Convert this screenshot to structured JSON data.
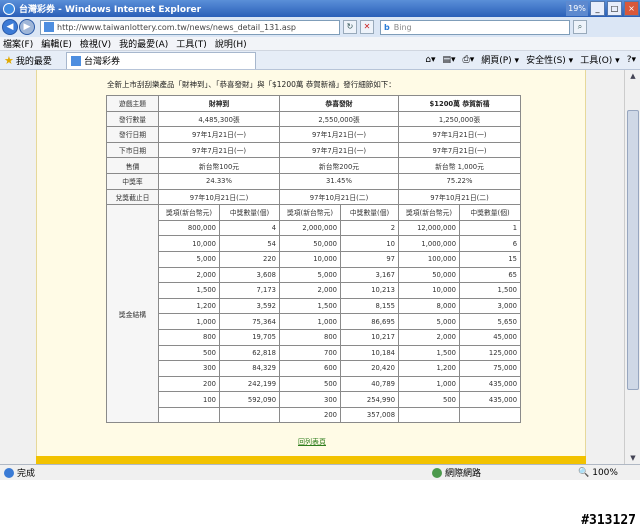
{
  "window": {
    "title": "台灣彩券 - Windows Internet Explorer",
    "percent": "19%"
  },
  "address": {
    "url": "http://www.taiwanlottery.com.tw/news/news_detail_131.asp",
    "search_placeholder": "Bing"
  },
  "menu": [
    "檔案(F)",
    "編輯(E)",
    "檢視(V)",
    "我的最愛(A)",
    "工具(T)",
    "說明(H)"
  ],
  "favorites": {
    "label": "我的最愛",
    "tab_title": "台灣彩券"
  },
  "toolbar": {
    "page": "網頁(P) ▾",
    "safety": "安全性(S) ▾",
    "tools": "工具(O) ▾"
  },
  "intro": "全新上市刮刮樂產品「財神到」、「恭喜發財」與「$1200萬 恭賀新禧」發行細節如下：",
  "table": {
    "game_label": "遊戲主題",
    "games": [
      "財神到",
      "恭喜發財",
      "$1200萬 恭賀新禧"
    ],
    "info_rows": [
      {
        "label": "發行數量",
        "values": [
          "4,485,300張",
          "2,550,000張",
          "1,250,000張"
        ]
      },
      {
        "label": "發行日期",
        "values": [
          "97年1月21日(一)",
          "97年1月21日(一)",
          "97年1月21日(一)"
        ]
      },
      {
        "label": "下市日期",
        "values": [
          "97年7月21日(一)",
          "97年7月21日(一)",
          "97年7月21日(一)"
        ]
      },
      {
        "label": "售價",
        "values": [
          "新台幣100元",
          "新台幣200元",
          "新台幣 1,000元"
        ]
      },
      {
        "label": "中獎率",
        "values": [
          "24.33%",
          "31.45%",
          "75.22%"
        ]
      },
      {
        "label": "兌獎截止日",
        "values": [
          "97年10月21日(二)",
          "97年10月21日(二)",
          "97年10月21日(二)"
        ]
      }
    ],
    "prize_label": "獎金結構",
    "prize_header": [
      "獎項(新台幣元)",
      "中獎數量(個)"
    ],
    "prize_rows": [
      [
        "800,000",
        "4",
        "2,000,000",
        "2",
        "12,000,000",
        "1"
      ],
      [
        "10,000",
        "54",
        "50,000",
        "10",
        "1,000,000",
        "6"
      ],
      [
        "5,000",
        "220",
        "10,000",
        "97",
        "100,000",
        "15"
      ],
      [
        "2,000",
        "3,608",
        "5,000",
        "3,167",
        "50,000",
        "65"
      ],
      [
        "1,500",
        "7,173",
        "2,000",
        "10,213",
        "10,000",
        "1,500"
      ],
      [
        "1,200",
        "3,592",
        "1,500",
        "8,155",
        "8,000",
        "3,000"
      ],
      [
        "1,000",
        "75,364",
        "1,000",
        "86,695",
        "5,000",
        "5,650"
      ],
      [
        "800",
        "19,705",
        "800",
        "10,217",
        "2,000",
        "45,000"
      ],
      [
        "500",
        "62,818",
        "700",
        "10,184",
        "1,500",
        "125,000"
      ],
      [
        "300",
        "84,329",
        "600",
        "20,420",
        "1,200",
        "75,000"
      ],
      [
        "200",
        "242,199",
        "500",
        "40,789",
        "1,000",
        "435,000"
      ],
      [
        "100",
        "592,090",
        "300",
        "254,990",
        "500",
        "435,000"
      ],
      [
        "",
        "",
        "200",
        "357,008",
        "",
        ""
      ]
    ]
  },
  "return_link": "回列表頁",
  "status": {
    "done": "完成",
    "network": "網際網路",
    "zoom": "100%"
  },
  "watermark": "#313127"
}
